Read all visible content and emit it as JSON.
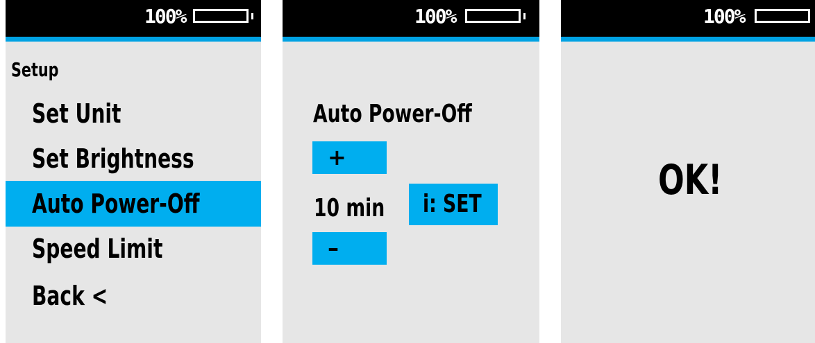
{
  "status_bar": {
    "battery_percent": "100%",
    "battery_level": 1.0,
    "accent_color": "#00a2e3"
  },
  "setup_menu": {
    "title": "Setup",
    "items": [
      {
        "label": "Set Unit",
        "selected": false
      },
      {
        "label": "Set Brightness",
        "selected": false
      },
      {
        "label": "Auto Power-Off",
        "selected": true
      },
      {
        "label": "Speed Limit",
        "selected": false
      },
      {
        "label": "Back <",
        "selected": false
      }
    ],
    "highlight_color": "#00aeef"
  },
  "auto_power_off": {
    "title": "Auto Power-Off",
    "increase_label": "+",
    "decrease_label": "–",
    "value": "10 min",
    "set_label": "i: SET"
  },
  "confirmation": {
    "message": "OK!"
  }
}
